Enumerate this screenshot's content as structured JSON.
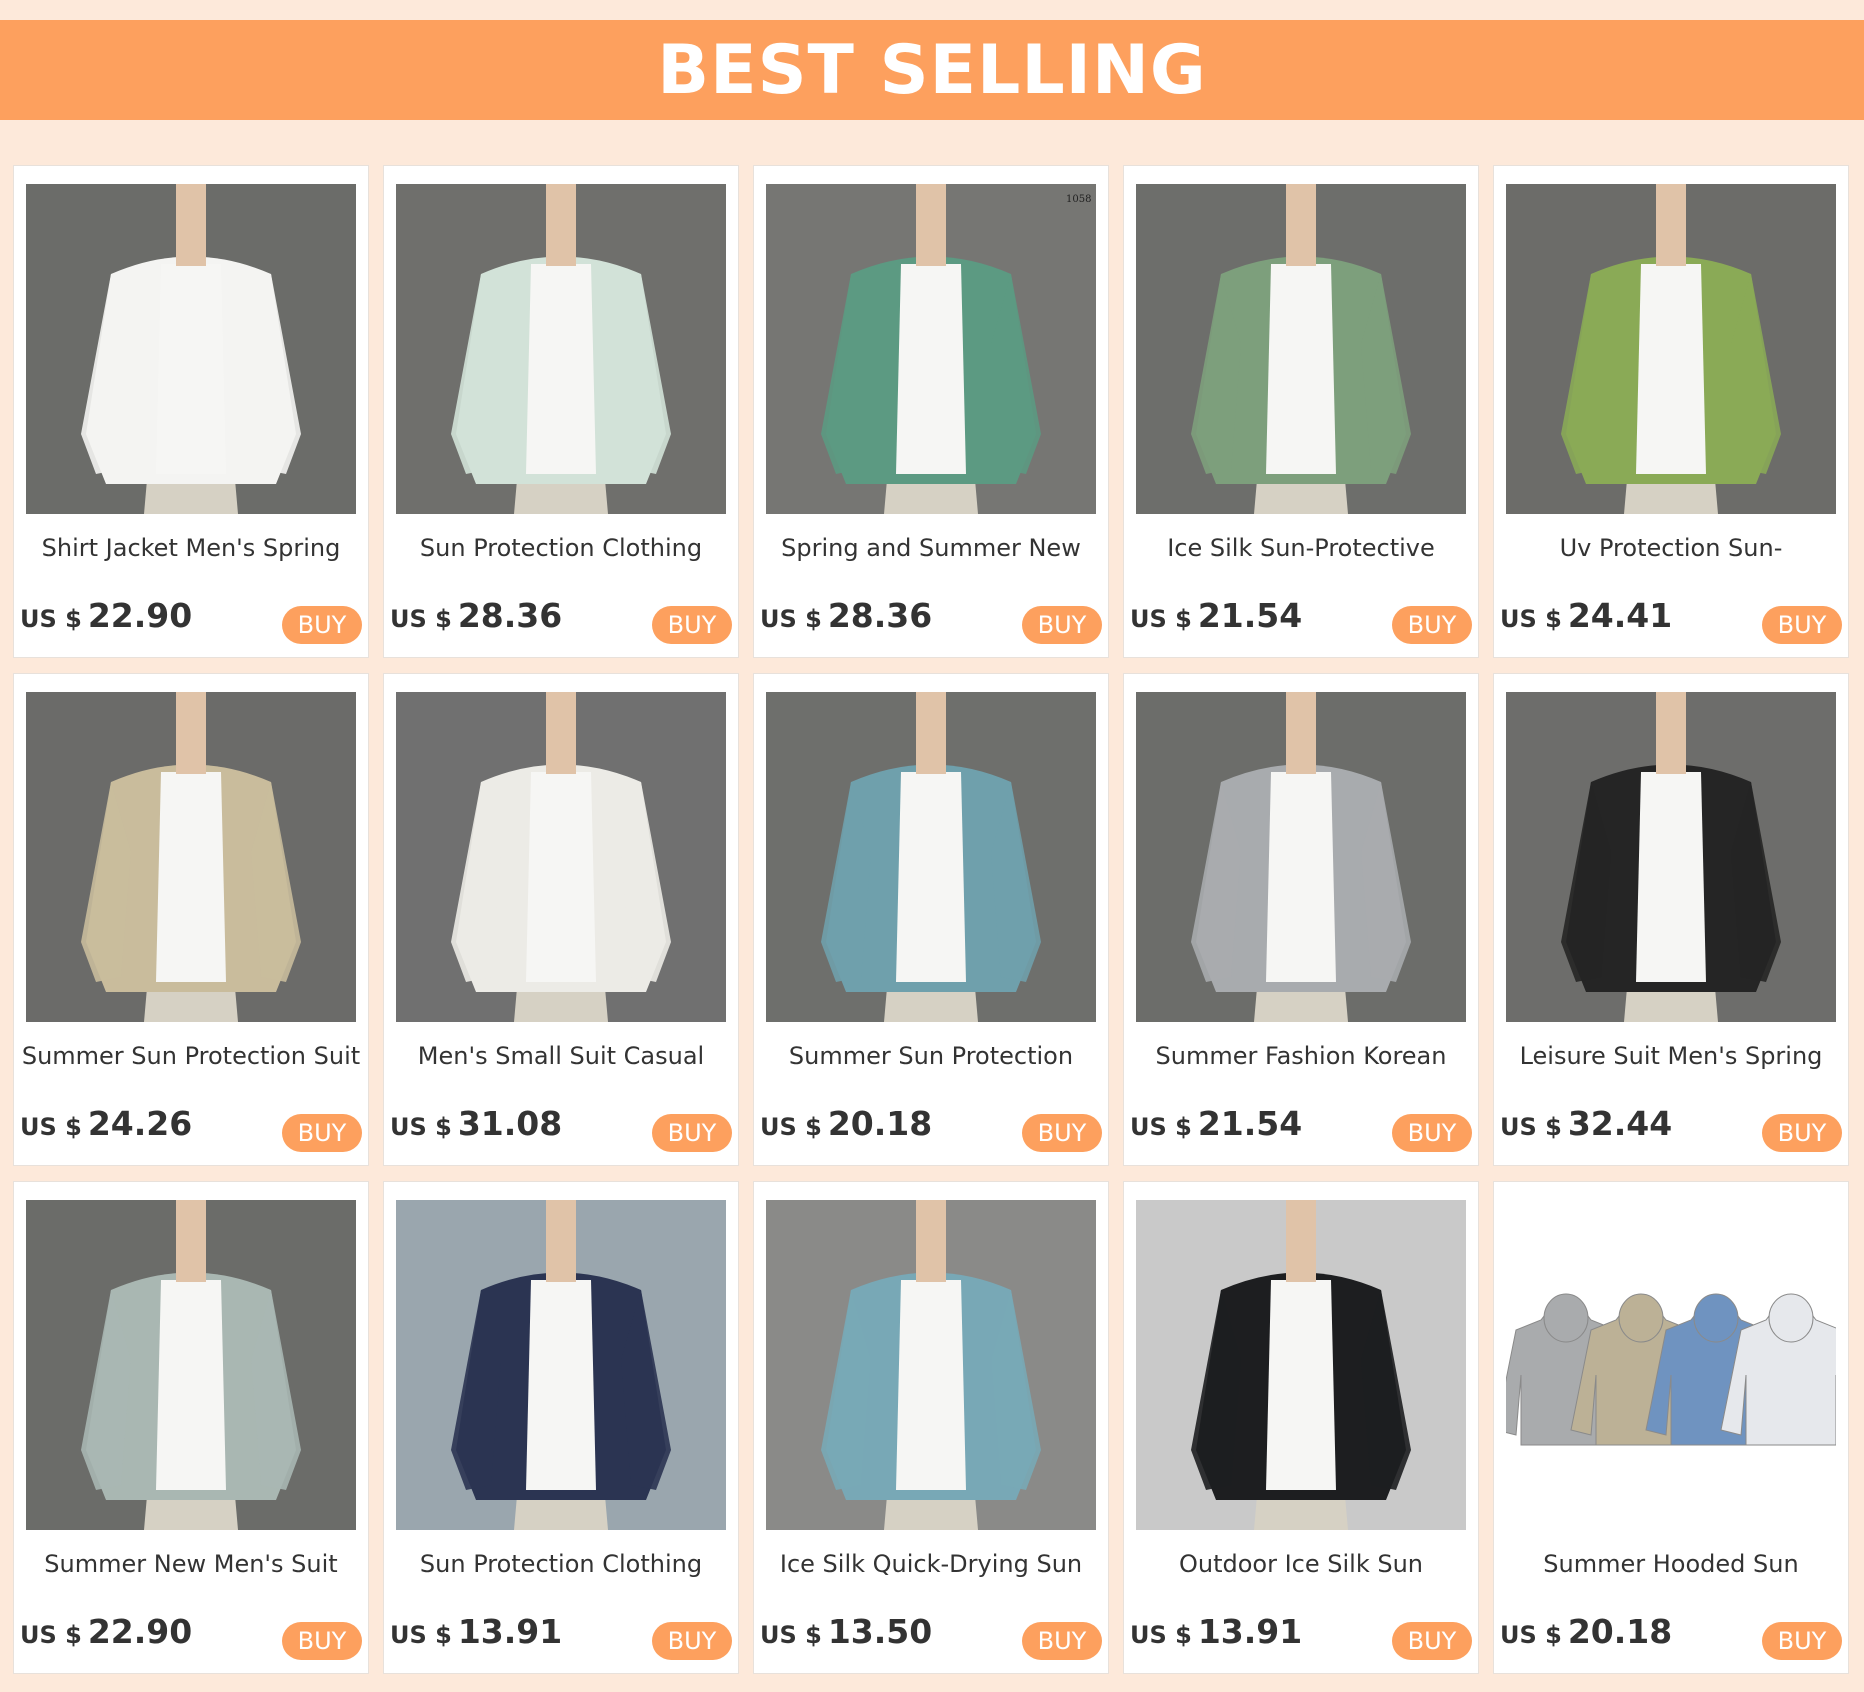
{
  "header": {
    "title": "BEST SELLING"
  },
  "colors": {
    "accent": "#fda05e",
    "background": "#fde9da"
  },
  "products": [
    {
      "title": "Shirt Jacket Men's Spring",
      "currency": "US $",
      "price": "22.90",
      "buy_label": "BUY",
      "garment": "#f4f4f2",
      "bg": "#6b6c69",
      "tag": ""
    },
    {
      "title": "Sun Protection Clothing",
      "currency": "US $",
      "price": "28.36",
      "buy_label": "BUY",
      "garment": "#d2e2d8",
      "bg": "#6f6f6c",
      "tag": ""
    },
    {
      "title": "Spring and Summer New",
      "currency": "US $",
      "price": "28.36",
      "buy_label": "BUY",
      "garment": "#5c9a82",
      "bg": "#767673",
      "tag": "1058"
    },
    {
      "title": "Ice Silk Sun-Protective",
      "currency": "US $",
      "price": "21.54",
      "buy_label": "BUY",
      "garment": "#7d9f7c",
      "bg": "#6d6e6b",
      "tag": ""
    },
    {
      "title": "Uv Protection Sun-",
      "currency": "US $",
      "price": "24.41",
      "buy_label": "BUY",
      "garment": "#8aaa56",
      "bg": "#6c6c69",
      "tag": ""
    },
    {
      "title": "Summer Sun Protection Suit",
      "currency": "US $",
      "price": "24.26",
      "buy_label": "BUY",
      "garment": "#c9bc9c",
      "bg": "#6b6b69",
      "tag": ""
    },
    {
      "title": "Men's Small Suit Casual",
      "currency": "US $",
      "price": "31.08",
      "buy_label": "BUY",
      "garment": "#ecebe6",
      "bg": "#707070",
      "tag": ""
    },
    {
      "title": "Summer Sun Protection",
      "currency": "US $",
      "price": "20.18",
      "buy_label": "BUY",
      "garment": "#6fa0ac",
      "bg": "#6e6f6c",
      "tag": ""
    },
    {
      "title": "Summer Fashion Korean",
      "currency": "US $",
      "price": "21.54",
      "buy_label": "BUY",
      "garment": "#a8abae",
      "bg": "#6c6d6a",
      "tag": ""
    },
    {
      "title": "Leisure Suit Men's Spring",
      "currency": "US $",
      "price": "32.44",
      "buy_label": "BUY",
      "garment": "#252525",
      "bg": "#6d6d6b",
      "tag": ""
    },
    {
      "title": "Summer New Men's Suit",
      "currency": "US $",
      "price": "22.90",
      "buy_label": "BUY",
      "garment": "#a9b7b2",
      "bg": "#6b6c69",
      "tag": ""
    },
    {
      "title": "Sun Protection Clothing",
      "currency": "US $",
      "price": "13.91",
      "buy_label": "BUY",
      "garment": "#2b3452",
      "bg": "#9aa6ae",
      "tag": ""
    },
    {
      "title": "Ice Silk Quick-Drying Sun",
      "currency": "US $",
      "price": "13.50",
      "buy_label": "BUY",
      "garment": "#78a8b6",
      "bg": "#8a8a88",
      "tag": ""
    },
    {
      "title": "Outdoor Ice Silk Sun",
      "currency": "US $",
      "price": "13.91",
      "buy_label": "BUY",
      "garment": "#1d1e20",
      "bg": "#c9c9c9",
      "tag": ""
    },
    {
      "title": "Summer Hooded Sun",
      "currency": "US $",
      "price": "20.18",
      "buy_label": "BUY",
      "garment": "#a9abad",
      "bg": "#ffffff",
      "tag": ""
    }
  ]
}
